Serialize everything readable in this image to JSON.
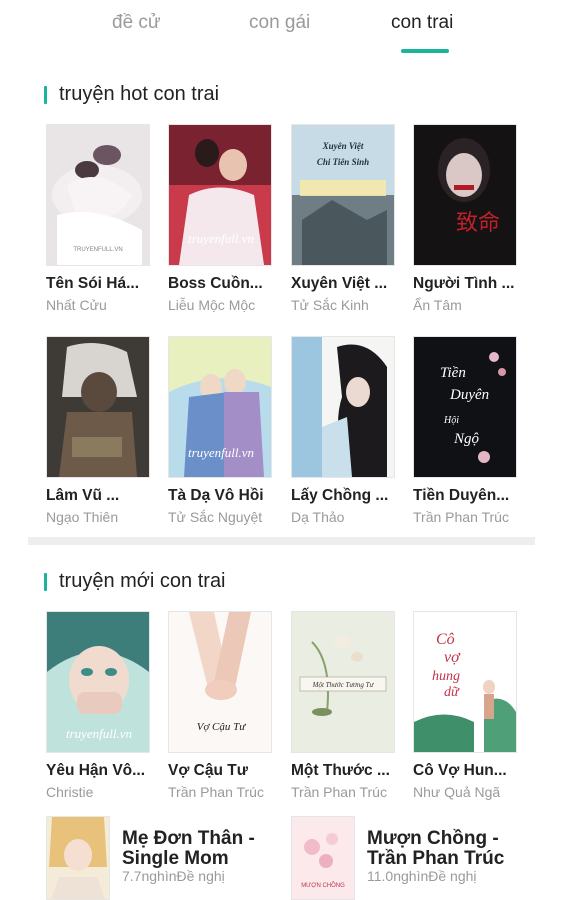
{
  "tabs": [
    {
      "label": "đề cử",
      "active": false
    },
    {
      "label": "con gái",
      "active": false
    },
    {
      "label": "con trai",
      "active": true
    }
  ],
  "colors": {
    "accent": "#1bb39a",
    "text": "#222222",
    "muted": "#9a9a9a"
  },
  "hot_section": {
    "title": "truyện hot con trai",
    "books": [
      {
        "title": "Tên Sói Há...",
        "author": "Nhất Cửu",
        "cover_caption": "TRUYENFULL.VN"
      },
      {
        "title": "Boss Cuồn...",
        "author": "Liễu Mộc Mộc",
        "cover_caption": "truyenfull.vn"
      },
      {
        "title": "Xuyên Việt ...",
        "author": "Tử Sắc Kinh",
        "cover_caption": "Xuyên Việt Chi Tiên Sinh"
      },
      {
        "title": "Người Tình ...",
        "author": "Ẩn Tâm",
        "cover_caption": "致命"
      },
      {
        "title": "Lâm Vũ ...",
        "author": "Ngạo Thiên",
        "cover_caption": ""
      },
      {
        "title": "Tà Dạ Vô Hồi",
        "author": "Tử Sắc Nguyệt",
        "cover_caption": "truyenfull.vn"
      },
      {
        "title": "Lấy Chồng ...",
        "author": "Dạ Thảo",
        "cover_caption": ""
      },
      {
        "title": "Tiền Duyên...",
        "author": "Trần Phan Trúc",
        "cover_caption": "Tiền Duyên Hội Ngộ"
      }
    ]
  },
  "new_section": {
    "title": "truyện mới con trai",
    "books": [
      {
        "title": "Yêu Hận Vô...",
        "author": "Christie",
        "cover_caption": "truyenfull.vn"
      },
      {
        "title": "Vợ Cậu Tư",
        "author": "Trần Phan Trúc",
        "cover_caption": "Vợ Cậu Tư"
      },
      {
        "title": "Một Thước ...",
        "author": "Trần Phan Trúc",
        "cover_caption": "Một Thước Tương Tư"
      },
      {
        "title": "Cô Vợ Hun...",
        "author": "Như Quả Ngã",
        "cover_caption": "Cô vợ hung dữ"
      }
    ]
  },
  "wide_books": [
    {
      "title": "Mẹ Đơn Thân - Single Mom",
      "meta": "7.7nghìnĐề nghị"
    },
    {
      "title": "Mượn Chồng - Trần Phan Trúc",
      "meta": "11.0nghìnĐề nghị",
      "cover_caption": "MƯỢN CHỒNG"
    }
  ]
}
